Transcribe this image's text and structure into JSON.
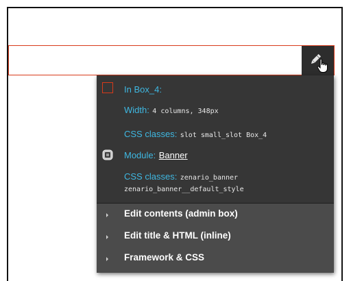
{
  "slot": {
    "in_label": "In Box_4:",
    "width_label": "Width:",
    "width_value": "4 columns, 348px",
    "css_label": "CSS classes:",
    "css_value": "slot small_slot Box_4"
  },
  "module": {
    "label": "Module:",
    "name": "Banner",
    "css_label": "CSS classes:",
    "css_value_line1": "zenario_banner",
    "css_value_line2": "zenario_banner__default_style"
  },
  "menu": {
    "items": [
      {
        "label": "Edit contents (admin box)"
      },
      {
        "label": "Edit title & HTML (inline)"
      },
      {
        "label": "Framework & CSS"
      }
    ]
  },
  "icons": {
    "edit": "pencil-icon",
    "cursor": "hand-pointer-icon",
    "slot": "slot-square-icon",
    "module": "module-icon",
    "menu_arrow": "triangle-right-icon"
  },
  "colors": {
    "label_blue": "#3fb8e2",
    "slot_red": "#d83a1a",
    "panel_bg": "#363636",
    "menu_bg": "#4b4b4b"
  }
}
